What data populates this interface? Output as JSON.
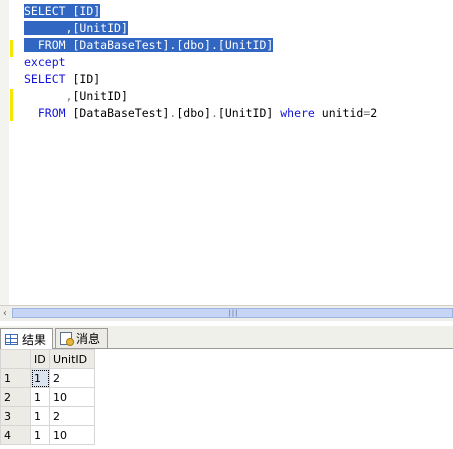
{
  "editor": {
    "lines": [
      {
        "indent": "",
        "parts": [
          {
            "t": "SELECT",
            "c": "kw"
          },
          {
            "t": " [ID]",
            "c": ""
          }
        ],
        "selected": true
      },
      {
        "indent": "      ",
        "parts": [
          {
            "t": ",",
            "c": "gray"
          },
          {
            "t": "[UnitID]",
            "c": ""
          }
        ],
        "selected": true
      },
      {
        "indent": "  ",
        "parts": [
          {
            "t": "FROM",
            "c": "kw"
          },
          {
            "t": " [DataBaseTest]",
            "c": ""
          },
          {
            "t": ".",
            "c": "gray"
          },
          {
            "t": "[dbo]",
            "c": ""
          },
          {
            "t": ".",
            "c": "gray"
          },
          {
            "t": "[UnitID]",
            "c": ""
          }
        ],
        "selected": true
      },
      {
        "indent": "",
        "parts": [
          {
            "t": "except",
            "c": "kw"
          }
        ],
        "selected": false
      },
      {
        "indent": "",
        "parts": [
          {
            "t": "SELECT",
            "c": "kw"
          },
          {
            "t": " [ID]",
            "c": ""
          }
        ],
        "selected": false
      },
      {
        "indent": "      ",
        "parts": [
          {
            "t": ",",
            "c": "gray"
          },
          {
            "t": "[UnitID]",
            "c": ""
          }
        ],
        "selected": false
      },
      {
        "indent": "  ",
        "parts": [
          {
            "t": "FROM",
            "c": "kw"
          },
          {
            "t": " [DataBaseTest]",
            "c": ""
          },
          {
            "t": ".",
            "c": "gray"
          },
          {
            "t": "[dbo]",
            "c": ""
          },
          {
            "t": ".",
            "c": "gray"
          },
          {
            "t": "[UnitID] ",
            "c": ""
          },
          {
            "t": "where",
            "c": "kw"
          },
          {
            "t": " unitid",
            "c": ""
          },
          {
            "t": "=",
            "c": "gray"
          },
          {
            "t": "2",
            "c": ""
          }
        ],
        "selected": false
      }
    ],
    "colors": {
      "keyword": "#1414d8",
      "selection": "#3166c2",
      "change_marker": "#f5e600"
    }
  },
  "scrollbar": {
    "left_arrow": "‹",
    "grip": "|||"
  },
  "tabs": [
    {
      "label": "结果",
      "icon": "grid-icon",
      "active": true
    },
    {
      "label": "消息",
      "icon": "message-icon",
      "active": false
    }
  ],
  "results": {
    "columns": [
      "ID",
      "UnitID"
    ],
    "rows": [
      {
        "num": "1",
        "cells": [
          "1",
          "2"
        ]
      },
      {
        "num": "2",
        "cells": [
          "1",
          "10"
        ]
      },
      {
        "num": "3",
        "cells": [
          "1",
          "2"
        ]
      },
      {
        "num": "4",
        "cells": [
          "1",
          "10"
        ]
      }
    ]
  }
}
